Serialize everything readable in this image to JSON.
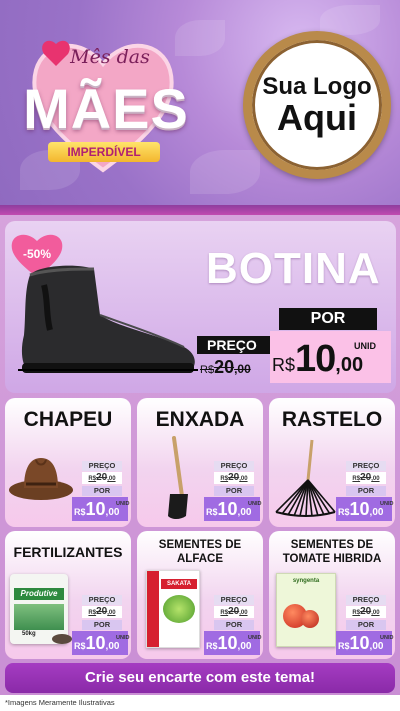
{
  "header": {
    "logo_line1": "Sua Logo",
    "logo_line2": "Aqui",
    "headline_top": "Mês das",
    "headline_main": "MÃES",
    "headline_tag": "IMPERDÍVEL"
  },
  "featured": {
    "title": "BOTINA",
    "discount": "-50%",
    "preco_label": "PREÇO",
    "por_label": "POR",
    "old_currency": "R$",
    "old_value": "20",
    "old_cents": ",00",
    "new_currency": "R$",
    "new_value": "10",
    "new_cents": ",00",
    "unit": "UNID"
  },
  "products": [
    {
      "title": "CHAPEU",
      "preco_label": "PREÇO",
      "old_currency": "R$",
      "old_value": "20",
      "old_cents": ",00",
      "por_label": "POR",
      "new_currency": "R$",
      "new_value": "10",
      "new_cents": ",00",
      "unit": "UNID"
    },
    {
      "title": "ENXADA",
      "preco_label": "PREÇO",
      "old_currency": "R$",
      "old_value": "20",
      "old_cents": ",00",
      "por_label": "POR",
      "new_currency": "R$",
      "new_value": "10",
      "new_cents": ",00",
      "unit": "UNID"
    },
    {
      "title": "RASTELO",
      "preco_label": "PREÇO",
      "old_currency": "R$",
      "old_value": "20",
      "old_cents": ",00",
      "por_label": "POR",
      "new_currency": "R$",
      "new_value": "10",
      "new_cents": ",00",
      "unit": "UNID"
    },
    {
      "title": "FERTILIZANTES",
      "preco_label": "PREÇO",
      "old_currency": "R$",
      "old_value": "20",
      "old_cents": ",00",
      "por_label": "POR",
      "new_currency": "R$",
      "new_value": "10",
      "new_cents": ",00",
      "unit": "UNID",
      "pack_brand": "Produtive",
      "pack_weight": "50kg"
    },
    {
      "title_line1": "SEMENTES DE",
      "title_line2": "ALFACE",
      "preco_label": "PREÇO",
      "old_currency": "R$",
      "old_value": "20",
      "old_cents": ",00",
      "por_label": "POR",
      "new_currency": "R$",
      "new_value": "10",
      "new_cents": ",00",
      "unit": "UNID",
      "pack_brand": "SAKATA"
    },
    {
      "title_line1": "SEMENTES DE",
      "title_line2": "TOMATE HIBRIDA",
      "preco_label": "PREÇO",
      "old_currency": "R$",
      "old_value": "20",
      "old_cents": ",00",
      "por_label": "POR",
      "new_currency": "R$",
      "new_value": "10",
      "new_cents": ",00",
      "unit": "UNID",
      "pack_brand": "syngenta"
    }
  ],
  "cta_label": "Crie seu encarte com este tema!",
  "footer_note": "*Imagens Meramente Ilustrativas",
  "colors": {
    "header_purple": "#9a72c8",
    "band_magenta": "#c14ab0",
    "price_purple": "#a06be2",
    "price_pink": "#fbc1e7",
    "cta_purple": "#a53cc2",
    "heart_pink": "#f25c9c"
  },
  "icons": [
    "heart-icon",
    "boot-image",
    "hat-image",
    "hoe-image",
    "rake-image",
    "fertilizer-bag-image",
    "seed-packet-image"
  ]
}
